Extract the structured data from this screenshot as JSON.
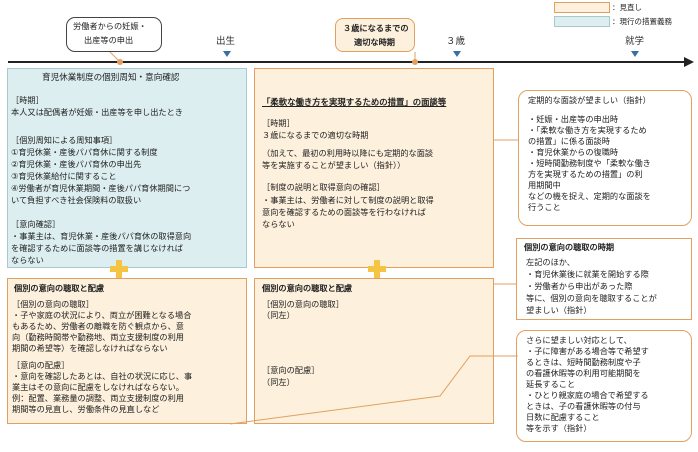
{
  "legend": [
    {
      "label": "：見直し",
      "color": "#fdf0dc",
      "border": "#e2a060"
    },
    {
      "label": "：現行の措置義務",
      "color": "#dceef0",
      "border": "#a9c9cf"
    }
  ],
  "timeline": {
    "callout_left": [
      "労働者からの妊娠・",
      "出産等の申出"
    ],
    "callout_center": [
      "３歳になるまでの",
      "適切な時期"
    ],
    "ticks": [
      "出生",
      "３歳",
      "就学"
    ]
  },
  "current": {
    "title": "育児休業制度の個別周知・意向確認",
    "lines": [
      "［時期］",
      " 本人又は配偶者が妊娠・出産等を申し出たとき",
      "",
      "［個別周知による周知事項］",
      " ①育児休業・産後パパ育休に関する制度",
      " ②育児休業・産後パパ育休の申出先",
      " ③育児休業給付に関すること",
      " ④労働者が育児休業期間・産後パパ育休期間につ",
      "   いて負担すべき社会保険料の取扱い",
      "",
      "［意向確認］",
      " ・事業主は、育児休業・産後パパ育休の取得意向",
      "   を確認するために面談等の措置を講じなければ",
      "   ならない"
    ]
  },
  "flex": {
    "title": "「柔軟な働き方を実現するための措置」の面談等",
    "lines": [
      "［時期］",
      "  ３歳になるまでの適切な時期",
      "",
      "  （加えて、最初の利用時以降にも定期的な面談",
      "   等を実施することが望ましい（指針））",
      "",
      "［制度の説明と取得意向の確認］",
      " ・事業主は、労働者に対して制度の説明と取得",
      "   意向を確認するための面談等を行わなければ",
      "   ならない"
    ]
  },
  "periodic": {
    "lines": [
      "定期的な面談が望ましい（指針）",
      "",
      "・妊娠・出産等の申出時",
      "・「柔軟な働き方を実現するため",
      "  の措置」に係る面談時",
      "・育児休業からの復職時",
      "・短時間勤務制度や「柔軟な働き",
      "  方を実現するための措置」の利",
      "  用期間中",
      "などの機を捉え、定期的な面談を",
      "行うこと"
    ]
  },
  "consider_left": {
    "title": "個別の意向の聴取と配慮",
    "lines": [
      "［個別の意向の聴取］",
      " ・子や家庭の状況により、両立が困難となる場合",
      "   もあるため、労働者の離職を防ぐ観点から、意",
      "   向（勤務時間帯や勤務地、両立支援制度の利用",
      "   期間の希望等）を確認しなければならない",
      "",
      "［意向の配慮］",
      " ・意向を確認したあとは、自社の状況に応じ、事",
      "   業主はその意向に配慮をしなければならない。",
      "    例：配置、業務量の調整、両立支援制度の利用",
      "        期間等の見直し、労働条件の見直しなど"
    ]
  },
  "consider_right": {
    "title": "個別の意向の聴取と配慮",
    "lines": [
      "［個別の意向の聴取］",
      "  （同左）",
      "",
      "",
      "",
      "",
      "［意向の配慮］",
      "  （同左）"
    ]
  },
  "timing": {
    "title": "個別の意向の聴取の時期",
    "lines": [
      " 左記のほか、",
      "  ・育児休業後に就業を開始する際",
      "  ・労働者から申出があった際",
      " 等に、個別の意向を聴取することが",
      " 望ましい（指針）"
    ]
  },
  "desirable": {
    "lines": [
      "さらに望ましい対応として、",
      " ・子に障害がある場合等で希望す",
      "   るときは、短時間勤務制度や子",
      "   の看護休暇等の利用可能期間を",
      "   延長すること",
      " ・ひとり親家庭の場合で希望する",
      "   ときは、子の看護休暇等の付与",
      "   日数に配慮すること",
      " 等を示す（指針）"
    ]
  }
}
